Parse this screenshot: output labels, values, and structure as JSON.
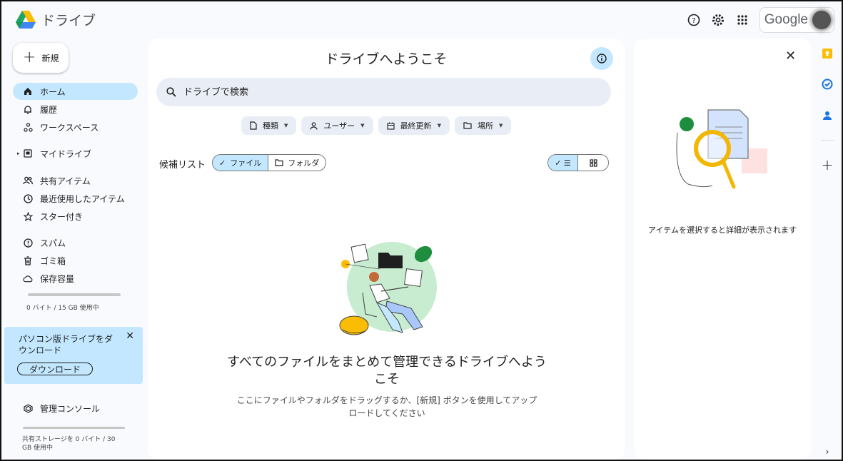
{
  "app": {
    "name": "ドライブ"
  },
  "topbar": {
    "help_icon": "help-icon",
    "settings_icon": "gear-icon",
    "apps_icon": "apps-grid-icon",
    "account_label": "Google"
  },
  "sidebar": {
    "new_label": "新規",
    "items": [
      {
        "label": "ホーム",
        "icon": "home-icon",
        "active": true
      },
      {
        "label": "履歴",
        "icon": "bell-icon"
      },
      {
        "label": "ワークスペース",
        "icon": "workspace-icon"
      },
      {
        "label": "マイドライブ",
        "icon": "my-drive-icon"
      },
      {
        "label": "共有アイテム",
        "icon": "people-icon"
      },
      {
        "label": "最近使用したアイテム",
        "icon": "clock-icon"
      },
      {
        "label": "スター付き",
        "icon": "star-icon"
      },
      {
        "label": "スパム",
        "icon": "spam-icon"
      },
      {
        "label": "ゴミ箱",
        "icon": "trash-icon"
      },
      {
        "label": "保存容量",
        "icon": "cloud-icon"
      }
    ],
    "storage_text": "0 バイト / 15 GB 使用中",
    "storage_used_fraction": 0,
    "promo": {
      "text": "パソコン版ドライブをダウンロード",
      "button": "ダウンロード"
    },
    "admin_label": "管理コンソール",
    "shared_storage_text": "共有ストレージを 0 バイト / 30 GB 使用中"
  },
  "main": {
    "title": "ドライブへようこそ",
    "search_placeholder": "ドライブで検索",
    "filters": [
      "種類",
      "ユーザー",
      "最終更新",
      "場所"
    ],
    "candidates_label": "候補リスト",
    "segment": {
      "files": "ファイル",
      "folders": "フォルダ"
    },
    "empty_title": "すべてのファイルをまとめて管理できるドライブへようこそ",
    "empty_sub": "ここにファイルやフォルダをドラッグするか、[新規] ボタンを使用してアップロードしてください"
  },
  "details": {
    "text": "アイテムを選択すると詳細が表示されます"
  },
  "colors": {
    "accent": "#c2e7ff",
    "search_bg": "#e9eef6",
    "page_bg": "#f8fafd"
  }
}
